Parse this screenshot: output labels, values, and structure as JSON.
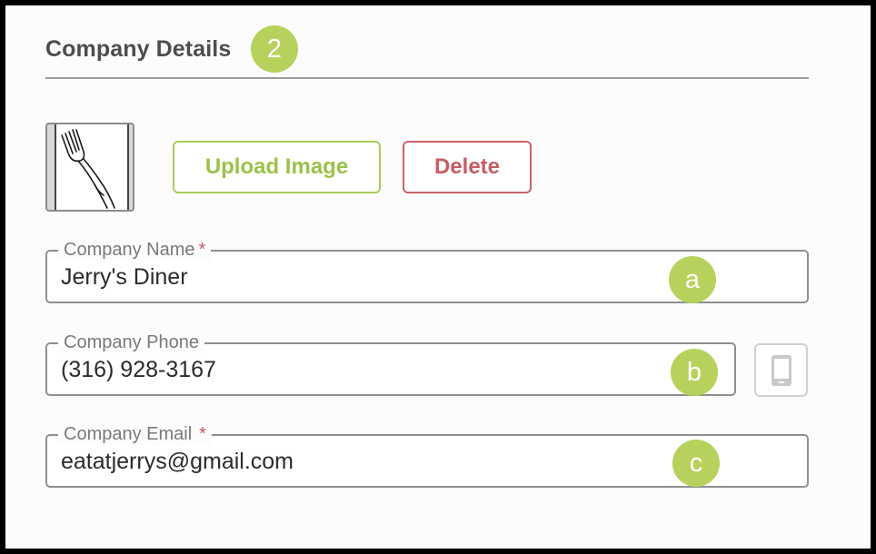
{
  "section": {
    "title": "Company Details",
    "step_badge": "2"
  },
  "image": {
    "icon": "fork-icon"
  },
  "buttons": {
    "upload_label": "Upload Image",
    "delete_label": "Delete"
  },
  "fields": {
    "name": {
      "label": "Company Name",
      "required_mark": "*",
      "value": "Jerry's Diner",
      "badge": "a"
    },
    "phone": {
      "label": "Company Phone",
      "value": "(316) 928-3167",
      "badge": "b",
      "icon": "mobile-phone-icon"
    },
    "email": {
      "label": "Company Email",
      "required_mark": "*",
      "value": "eatatjerrys@gmail.com",
      "badge": "c"
    }
  },
  "colors": {
    "accent_green": "#b7d25c",
    "delete_red": "#c85d64",
    "upload_green": "#9bc24a"
  }
}
